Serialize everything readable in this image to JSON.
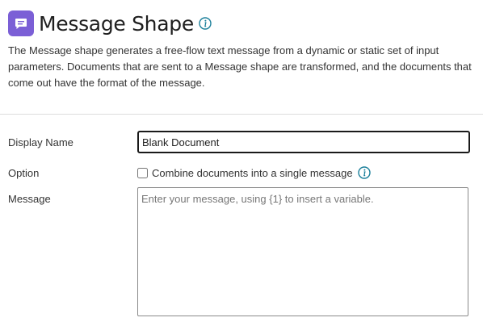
{
  "header": {
    "title": "Message Shape",
    "shape_icon": "message-bubble-icon",
    "info_icon": "info-icon",
    "accent_color": "#7b5fd6",
    "info_color": "#1b7f9a"
  },
  "description": "The Message shape generates a free-flow text message from a dynamic or static set of input parameters. Documents that are sent to a Message shape are transformed, and the documents that come out have the format of the message.",
  "form": {
    "display_name": {
      "label": "Display Name",
      "value": "Blank Document"
    },
    "option": {
      "label": "Option",
      "checkbox_label": "Combine documents into a single message",
      "checked": false,
      "info_icon": "info-icon"
    },
    "message": {
      "label": "Message",
      "placeholder": "Enter your message, using {1} to insert a variable.",
      "value": ""
    }
  }
}
